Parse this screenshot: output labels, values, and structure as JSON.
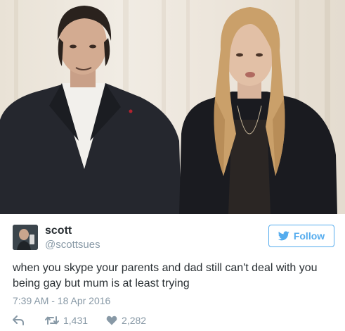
{
  "tweet": {
    "name": "scott",
    "handle": "@scottsues",
    "follow_label": "Follow",
    "text": "when you skype your parents and dad still can't deal with you being gay but mum is at least trying",
    "timestamp": "7:39 AM - 18 Apr 2016",
    "retweets": "1,431",
    "likes": "2,282"
  },
  "icons": {
    "follow": "bird-icon",
    "reply": "reply-icon",
    "retweet": "retweet-icon",
    "like": "heart-icon"
  },
  "colors": {
    "accent": "#55acee",
    "muted": "#8899a6",
    "text": "#292f33"
  }
}
